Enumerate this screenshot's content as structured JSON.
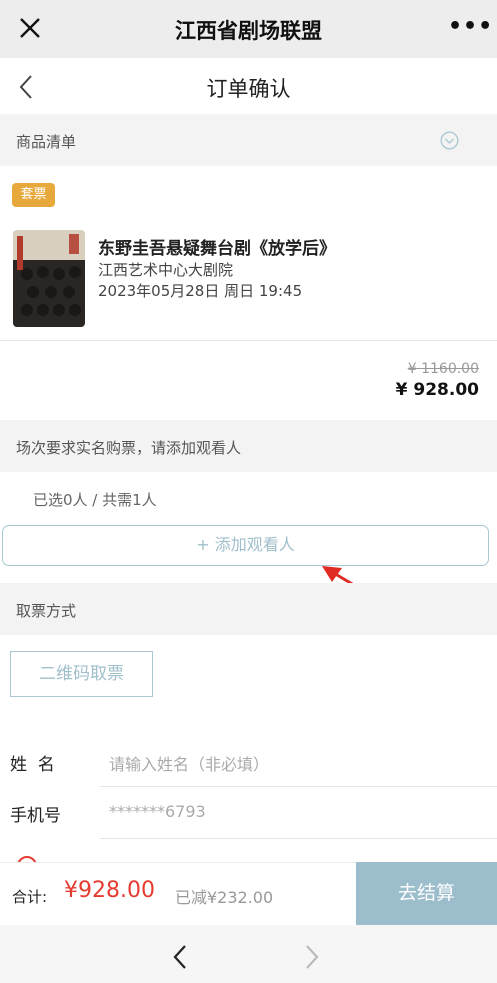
{
  "wechat": {
    "title": "江西省剧场联盟",
    "more": "•••"
  },
  "header": {
    "title": "订单确认"
  },
  "goods_section": {
    "label": "商品清单"
  },
  "item": {
    "tag": "套票",
    "title": "东野圭吾悬疑舞台剧《放学后》",
    "venue": "江西艺术中心大剧院",
    "datetime": "2023年05月28日 周日 19:45",
    "price_original": "¥ 1160.00",
    "price_current": "¥ 928.00"
  },
  "viewer_section": {
    "notice": "场次要求实名购票，请添加观看人",
    "selected": "已选0人 / 共需1人",
    "add_button": "+ 添加观看人"
  },
  "pickup_section": {
    "label": "取票方式",
    "method": "二维码取票"
  },
  "form": {
    "name_label": "姓  名",
    "name_placeholder": "请输入姓名（非必填）",
    "phone_label": "手机号",
    "phone_value": "*******6793"
  },
  "footer": {
    "total_label": "合计:",
    "total_value": "¥928.00",
    "reduced": "已减¥232.00",
    "checkout": "去结算"
  },
  "colors": {
    "accent_price": "#e53b30",
    "button_blue": "#9cbdcc",
    "tag_orange": "#e7a93c"
  }
}
